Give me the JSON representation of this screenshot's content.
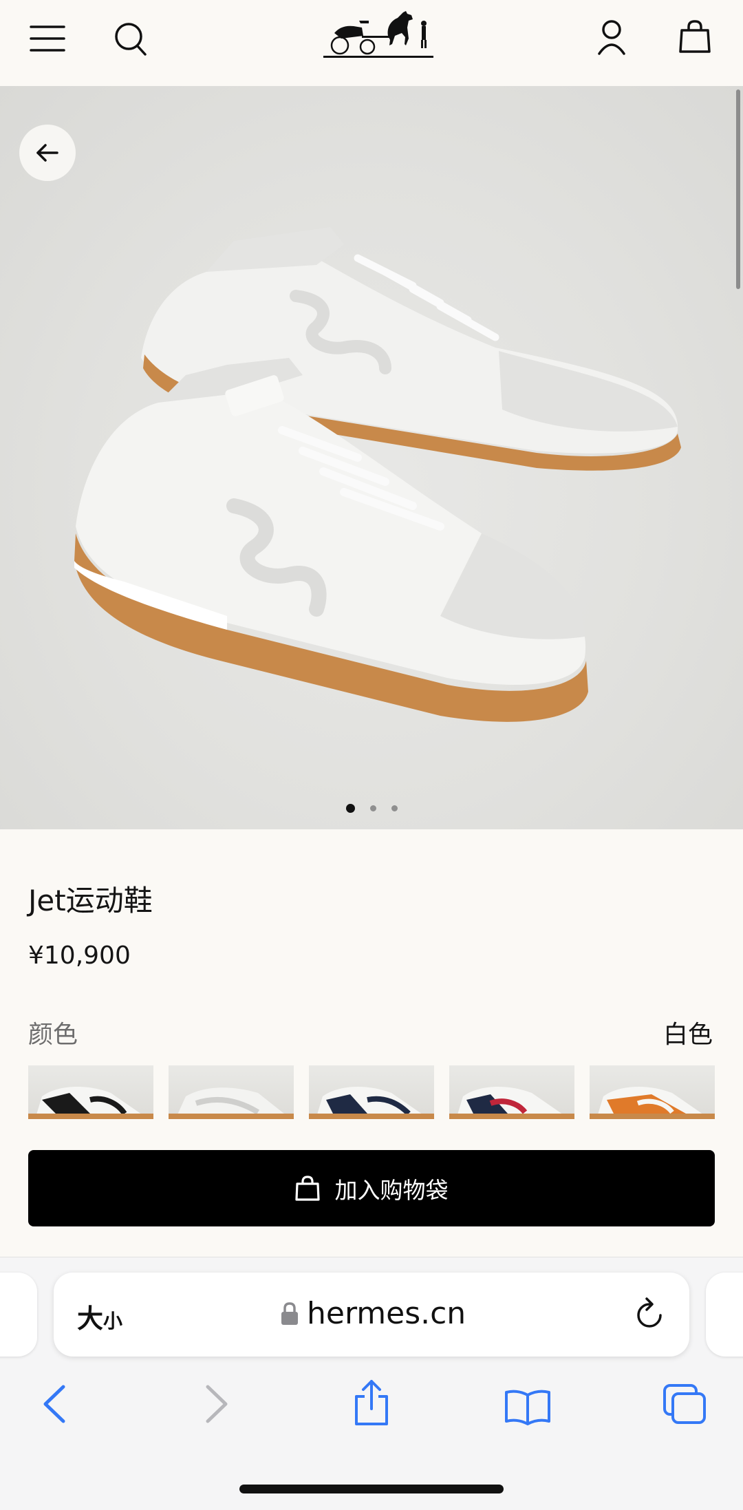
{
  "header": {
    "icons": [
      "menu-icon",
      "search-icon",
      "hermes-logo",
      "account-icon",
      "shopping-bag-icon"
    ]
  },
  "gallery": {
    "image": "white-suede-and-leather-sneakers-pair",
    "dots_total": 3,
    "dots_active": 1
  },
  "product": {
    "title": "Jet运动鞋",
    "price": "¥10,900",
    "color_label": "颜色",
    "color_value": "白色",
    "swatches": [
      "black-white",
      "grey-white",
      "navy-white",
      "navy-red",
      "orange-white"
    ],
    "add_to_bag_label": "加入购物袋"
  },
  "browser": {
    "text_size_label_big": "大",
    "text_size_label_small": "小",
    "url": "hermes.cn",
    "toolbar_icons": [
      "back-icon",
      "forward-icon",
      "share-icon",
      "bookmarks-icon",
      "tabs-icon"
    ]
  },
  "colors": {
    "background": "#fbf9f5",
    "button": "#000000",
    "safari_blue": "#3478f6",
    "sole": "#c88a4a"
  }
}
